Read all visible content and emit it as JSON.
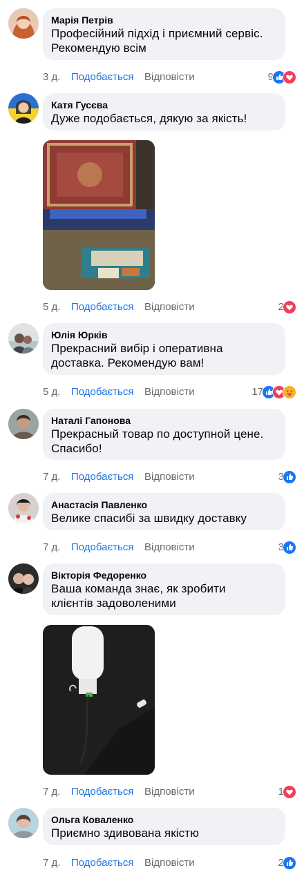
{
  "actions": {
    "like": "Подобається",
    "reply": "Відповісти"
  },
  "comments": [
    {
      "author": "Марія Петрів",
      "text": [
        "Професійний підхід і приємний сервіс.",
        "Рекомендую всім"
      ],
      "time": "3 д.",
      "reactions": "9",
      "icons": [
        "like-icon",
        "love-icon"
      ]
    },
    {
      "author": "Катя Гусєва",
      "text": [
        "Дуже подобається, дякую за якість!"
      ],
      "time": "5 д.",
      "reactions": "2",
      "icons": [
        "love-icon"
      ]
    },
    {
      "author": "Юлія Юрків",
      "text": [
        "Прекрасний вибір і оперативна",
        "доставка. Рекомендую вам!"
      ],
      "time": "5 д.",
      "reactions": "17",
      "icons": [
        "like-icon",
        "love-icon",
        "care-icon"
      ]
    },
    {
      "author": "Наталі Гапонова",
      "text": [
        "Прекрасный товар по доступной цене.",
        "Спасибо!"
      ],
      "time": "7 д.",
      "reactions": "3",
      "icons": [
        "like-icon"
      ]
    },
    {
      "author": "Анастасія Павленко",
      "text": [
        "Велике спасибі за швидку доставку"
      ],
      "time": "7 д.",
      "reactions": "3",
      "icons": [
        "like-icon"
      ]
    },
    {
      "author": "Вікторія Федоренко",
      "text": [
        "Ваша команда знає, як зробити",
        "клієнтів задоволеними"
      ],
      "time": "7 д.",
      "reactions": "1",
      "icons": [
        "love-icon"
      ]
    },
    {
      "author": "Ольга Коваленко",
      "text": [
        "Приємно здивована якістю"
      ],
      "time": "7 д.",
      "reactions": "2",
      "icons": [
        "like-icon"
      ]
    }
  ],
  "colors": {
    "bubble": "#f0f2f5",
    "link": "#1b74e4",
    "meta": "#65676b",
    "like": "#1877f2",
    "love": "#f33e58",
    "care": "#f7b125"
  }
}
